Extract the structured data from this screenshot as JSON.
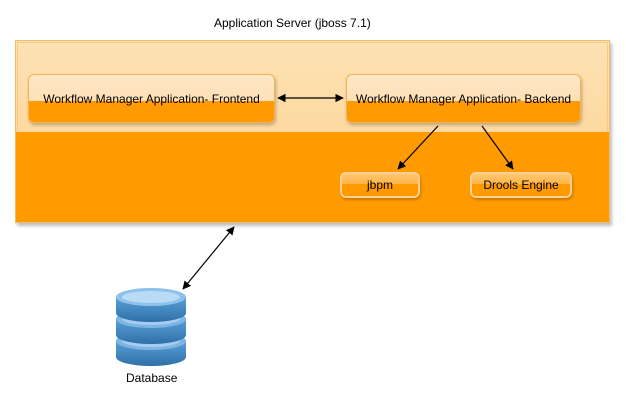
{
  "diagram": {
    "server_title": "Application Server (jboss 7.1)",
    "nodes": {
      "frontend": "Workflow Manager Application- Frontend",
      "backend": "Workflow Manager Application- Backend",
      "jbpm": "jbpm",
      "drools": "Drools Engine",
      "database": "Database"
    },
    "colors": {
      "container_top": "#fdd9a0",
      "container_bottom": "#ff9a00",
      "db_body": "#3f86c1",
      "db_light": "#a6cdef"
    },
    "edges": [
      {
        "from": "frontend",
        "to": "backend",
        "style": "bidirectional"
      },
      {
        "from": "backend",
        "to": "jbpm",
        "style": "directed"
      },
      {
        "from": "backend",
        "to": "drools",
        "style": "directed"
      },
      {
        "from": "database",
        "to": "application-server",
        "style": "bidirectional"
      }
    ]
  }
}
